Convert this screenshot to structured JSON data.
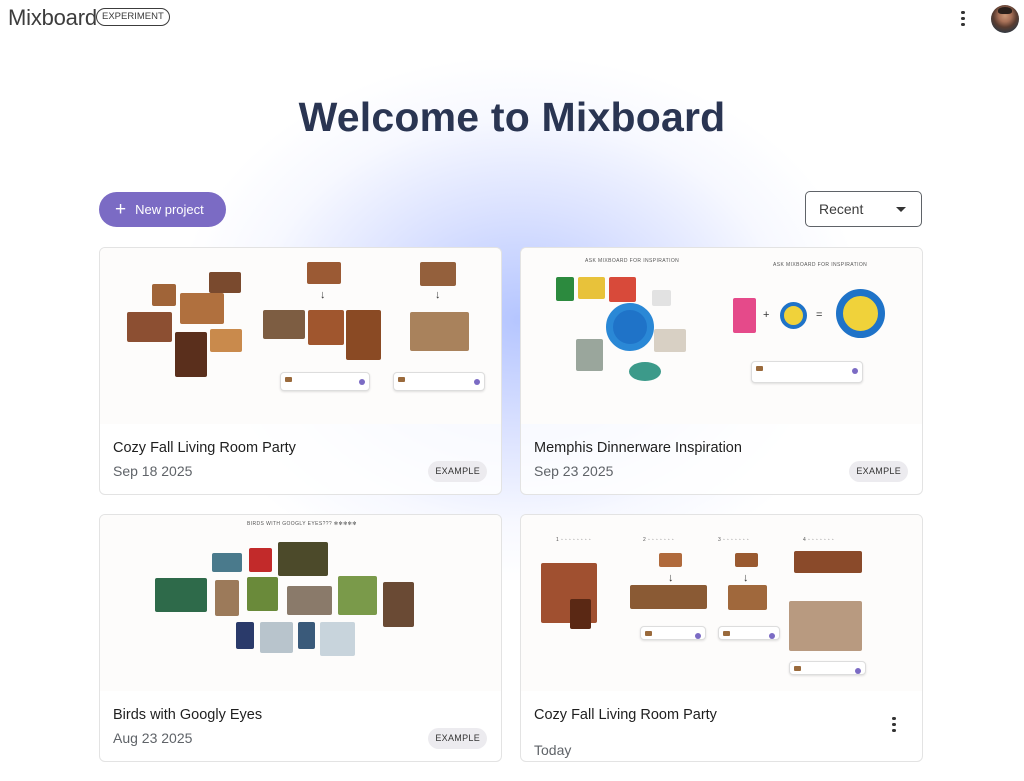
{
  "app": {
    "name": "Mixboard",
    "badge": "EXPERIMENT"
  },
  "header": {
    "more_icon": "more-vert-icon",
    "avatar_icon": "user-avatar"
  },
  "welcome": {
    "title": "Welcome to Mixboard"
  },
  "toolbar": {
    "new_project_label": "New project",
    "sort_value": "Recent"
  },
  "projects": [
    {
      "title": "Cozy Fall Living Room Party",
      "date": "Sep 18 2025",
      "badge": "EXAMPLE"
    },
    {
      "title": "Memphis Dinnerware Inspiration",
      "date": "Sep 23 2025",
      "badge": "EXAMPLE"
    },
    {
      "title": "Birds with Googly Eyes",
      "date": "Aug 23 2025",
      "badge": "EXAMPLE"
    },
    {
      "title": "Cozy Fall Living Room Party",
      "date": "Today",
      "badge": ""
    }
  ],
  "colors": {
    "accent": "#7b6bc4",
    "title": "#2a3552"
  }
}
